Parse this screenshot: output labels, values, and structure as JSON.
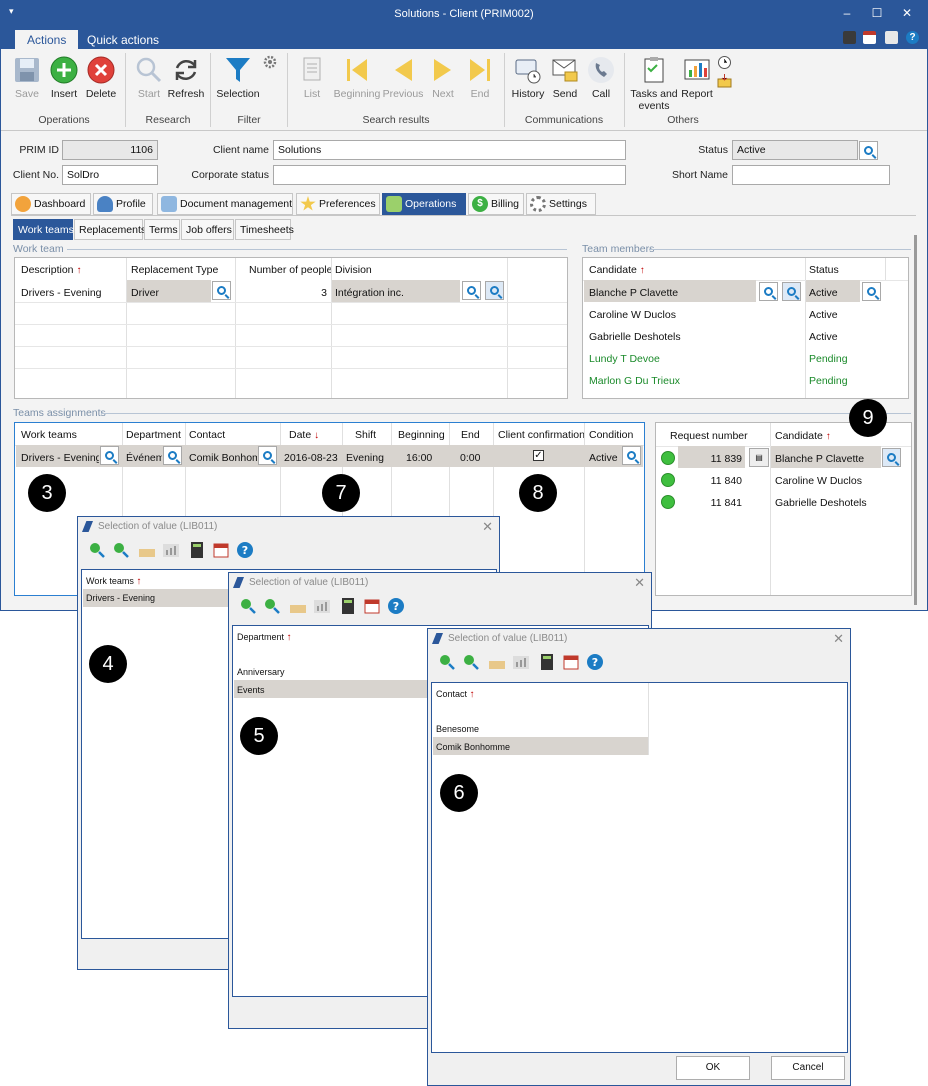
{
  "window": {
    "title": "Solutions - Client (PRIM002)"
  },
  "ribbon": {
    "tabs": [
      "Actions",
      "Quick actions"
    ],
    "buttons": {
      "save": "Save",
      "insert": "Insert",
      "delete": "Delete",
      "start": "Start",
      "refresh": "Refresh",
      "selection": "Selection",
      "list": "List",
      "beginning": "Beginning",
      "previous": "Previous",
      "next": "Next",
      "end": "End",
      "history": "History",
      "send": "Send",
      "call": "Call",
      "tasks_line1": "Tasks and",
      "tasks_line2": "events",
      "report": "Report"
    },
    "groups": {
      "operations": "Operations",
      "research": "Research",
      "filter": "Filter",
      "search_results": "Search results",
      "communications": "Communications",
      "others": "Others"
    }
  },
  "header": {
    "prim_id_label": "PRIM ID",
    "prim_id": "1106",
    "client_name_label": "Client name",
    "client_name": "Solutions",
    "status_label": "Status",
    "status": "Active",
    "client_no_label": "Client No.",
    "client_no": "SolDro",
    "corporate_status_label": "Corporate status",
    "corporate_status": "",
    "short_name_label": "Short Name",
    "short_name": ""
  },
  "main_tabs": [
    "Dashboard",
    "Profile",
    "Document management",
    "Preferences",
    "Operations",
    "Billing",
    "Settings"
  ],
  "sub_tabs": [
    "Work teams",
    "Replacements",
    "Terms",
    "Job offers",
    "Timesheets"
  ],
  "work_team": {
    "section_title": "Work team",
    "columns": [
      "Description",
      "Replacement Type",
      "Number of people",
      "Division"
    ],
    "rows": [
      {
        "description": "Drivers - Evening",
        "replacement_type": "Driver",
        "number": "3",
        "division": "Intégration inc."
      }
    ]
  },
  "team_members": {
    "section_title": "Team members",
    "columns": [
      "Candidate",
      "Status"
    ],
    "rows": [
      {
        "candidate": "Blanche P Clavette",
        "status": "Active"
      },
      {
        "candidate": "Caroline W Duclos",
        "status": "Active"
      },
      {
        "candidate": "Gabrielle Deshotels",
        "status": "Active"
      },
      {
        "candidate": "Lundy T Devoe",
        "status": "Pending"
      },
      {
        "candidate": "Marlon G Du Trieux",
        "status": "Pending"
      }
    ]
  },
  "assignments": {
    "section_title": "Teams assignments",
    "columns": [
      "Work teams",
      "Department",
      "Contact",
      "Date",
      "Shift",
      "Beginning",
      "End",
      "Client confirmation",
      "Condition"
    ],
    "row": {
      "work_teams": "Drivers - Evening",
      "department": "Événement",
      "contact": "Comik Bonhomme",
      "date": "2016-08-23",
      "shift": "Evening",
      "beginning": "16:00",
      "end": "0:00",
      "client_confirmation": "✓",
      "condition": "Active"
    }
  },
  "requests": {
    "columns": [
      "Request number",
      "Candidate"
    ],
    "rows": [
      {
        "number": "11 839",
        "candidate": "Blanche P Clavette"
      },
      {
        "number": "11 840",
        "candidate": "Caroline W Duclos"
      },
      {
        "number": "11 841",
        "candidate": "Gabrielle Deshotels"
      }
    ]
  },
  "callouts": [
    "3",
    "4",
    "5",
    "6",
    "7",
    "8",
    "9"
  ],
  "dialogs": {
    "title": "Selection of value (LIB011)",
    "work_teams": {
      "column": "Work teams",
      "items": [
        "Drivers - Evening"
      ]
    },
    "department": {
      "column": "Department",
      "items": [
        "Anniversary",
        "Events"
      ]
    },
    "contact": {
      "column": "Contact",
      "items": [
        "Benesome",
        "Comik Bonhomme"
      ]
    },
    "ok": "OK",
    "cancel": "Cancel"
  },
  "colors": {
    "accent": "#2b579a",
    "selected_row": "#d8d4cf",
    "pending": "#1a8a2a",
    "sort_arrow": "#c00000"
  }
}
